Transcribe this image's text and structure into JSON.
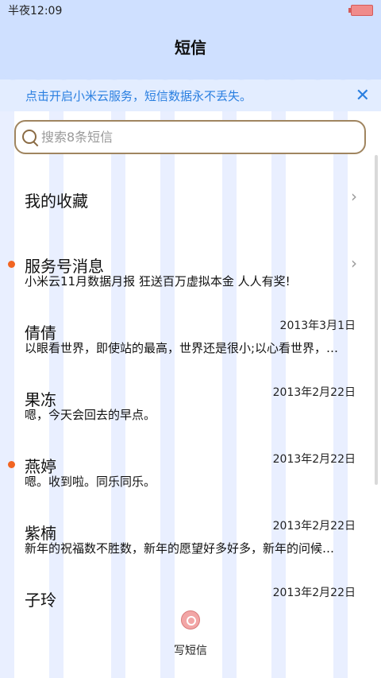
{
  "status_bar": {
    "time": "半夜12:09"
  },
  "header": {
    "title": "短信"
  },
  "banner": {
    "text": "点击开启小米云服务，短信数据永不丢失。",
    "close": "✕"
  },
  "search": {
    "placeholder": "搜索8条短信"
  },
  "favorites": {
    "label": "我的收藏"
  },
  "conversations": [
    {
      "name": "服务号消息",
      "preview": "小米云11月数据月报 狂送百万虚拟本金 人人有奖!",
      "date": "",
      "unread": true,
      "chevron": true
    },
    {
      "name": "倩倩",
      "preview": "以眼看世界，即使站的最高，世界还是很小;以心看世界，…",
      "date": "2013年3月1日",
      "unread": false
    },
    {
      "name": "果冻",
      "preview": "嗯，今天会回去的早点。",
      "date": "2013年2月22日",
      "unread": false
    },
    {
      "name": "燕婷",
      "preview": "嗯。收到啦。同乐同乐。",
      "date": "2013年2月22日",
      "unread": true
    },
    {
      "name": "紫楠",
      "preview": "新年的祝福数不胜数，新年的愿望好多好多，新年的问候…",
      "date": "2013年2月22日",
      "unread": false
    },
    {
      "name": "子玲",
      "preview": "",
      "date": "2013年2月22日",
      "unread": false
    }
  ],
  "compose": {
    "label": "写短信"
  }
}
